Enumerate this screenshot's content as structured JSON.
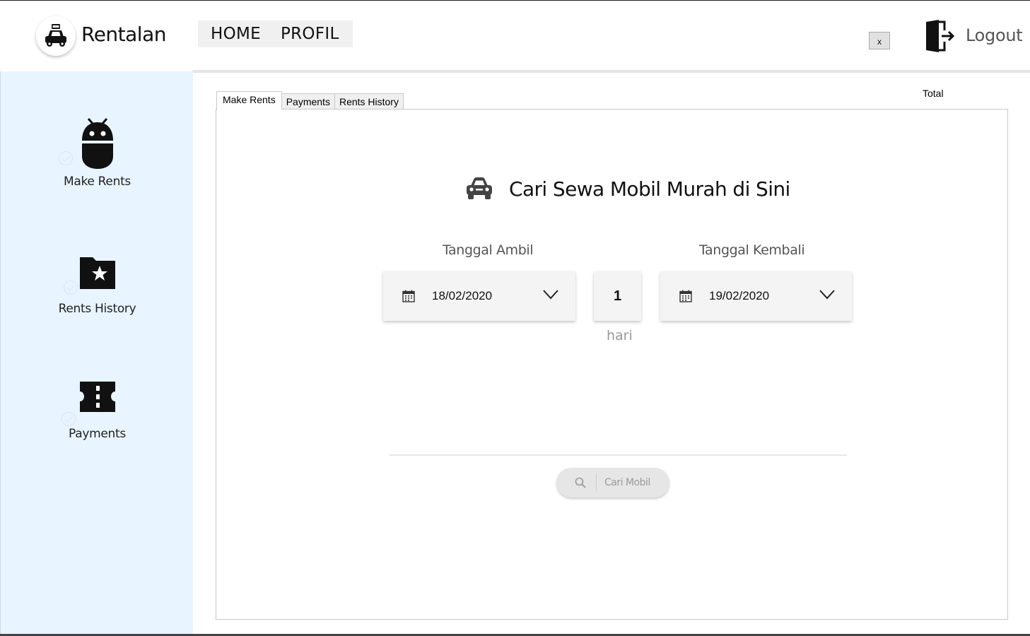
{
  "app": {
    "title": "Rentalan"
  },
  "topnav": {
    "items": [
      {
        "label": "HOME"
      },
      {
        "label": "PROFIL"
      }
    ]
  },
  "window": {
    "close_label": "x"
  },
  "logout": {
    "label": "Logout"
  },
  "sidebar": {
    "items": [
      {
        "label": "Make Rents",
        "icon": "android-robot-icon"
      },
      {
        "label": "Rents History",
        "icon": "star-folder-icon"
      },
      {
        "label": "Payments",
        "icon": "ticket-icon"
      }
    ]
  },
  "tabs": [
    {
      "label": "Make Rents",
      "active": true
    },
    {
      "label": "Payments"
    },
    {
      "label": "Rents History"
    }
  ],
  "summary": {
    "total_label": "Total"
  },
  "search_form": {
    "heading": "Cari Sewa Mobil Murah di Sini",
    "pickup": {
      "label": "Tanggal Ambil",
      "value": "18/02/2020"
    },
    "return": {
      "label": "Tanggal Kembali",
      "value": "19/02/2020"
    },
    "duration": {
      "value": "1",
      "unit": "hari"
    },
    "search_button": {
      "label": "Cari Mobil"
    }
  },
  "colors": {
    "sidebar_bg": "#e8f4ff",
    "button_bg": "#e6e6e6",
    "muted_text": "#999999"
  }
}
